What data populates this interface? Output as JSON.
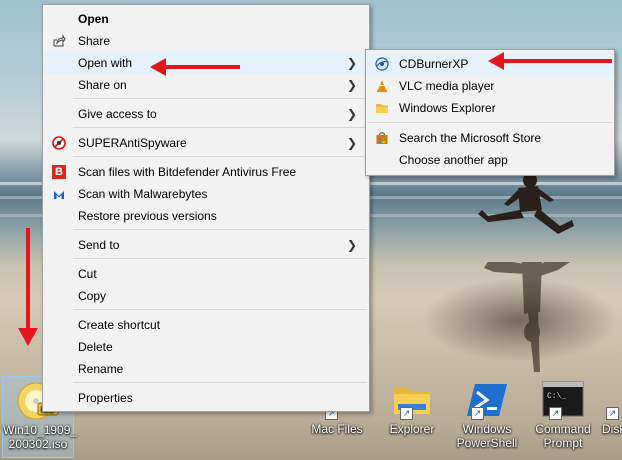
{
  "main_menu": {
    "items": [
      {
        "label": "Open",
        "icon": "",
        "bold": true
      },
      {
        "label": "Share",
        "icon": "share-icon"
      },
      {
        "label": "Open with",
        "submenu": true,
        "highlighted": true
      },
      {
        "label": "Share on",
        "submenu": true
      },
      {
        "label": "Give access to",
        "submenu": true
      },
      {
        "label": "SUPERAntiSpyware",
        "icon": "superantispyware-icon",
        "submenu": true
      },
      {
        "label": "Scan files with Bitdefender Antivirus Free",
        "icon": "bitdefender-icon"
      },
      {
        "label": "Scan with Malwarebytes",
        "icon": "malwarebytes-icon"
      },
      {
        "label": "Restore previous versions"
      },
      {
        "label": "Send to",
        "submenu": true
      },
      {
        "label": "Cut"
      },
      {
        "label": "Copy"
      },
      {
        "label": "Create shortcut"
      },
      {
        "label": "Delete"
      },
      {
        "label": "Rename"
      },
      {
        "label": "Properties"
      }
    ]
  },
  "open_with_menu": {
    "items": [
      {
        "label": "CDBurnerXP",
        "icon": "cdburnerxp-icon",
        "highlighted": true
      },
      {
        "label": "VLC media player",
        "icon": "vlc-cone-icon"
      },
      {
        "label": "Windows Explorer",
        "icon": "folder-icon"
      },
      {
        "label": "Search the Microsoft Store",
        "icon": "store-bag-icon"
      },
      {
        "label": "Choose another app"
      }
    ]
  },
  "desktop": {
    "iso_file": {
      "label_line1": "Win10_1909_",
      "label_line2": "200302.iso"
    },
    "icons": [
      {
        "label": "Mac Files"
      },
      {
        "label": "Explorer"
      },
      {
        "label_line1": "Windows",
        "label_line2": "PowerShell"
      },
      {
        "label_line1": "Command",
        "label_line2": "Prompt"
      },
      {
        "label": "Disk"
      }
    ]
  },
  "colors": {
    "arrow_red": "#e3171b",
    "menu_bg": "#f2f2f2",
    "highlight": "#e5f1fb"
  }
}
